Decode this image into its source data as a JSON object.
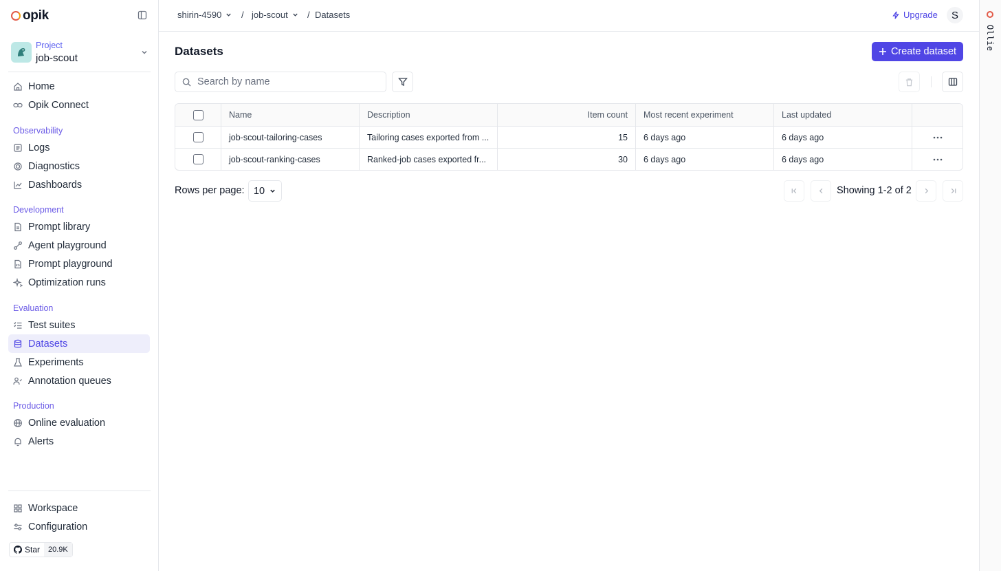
{
  "brand": {
    "name": "opik"
  },
  "project": {
    "label": "Project",
    "name": "job-scout"
  },
  "sidebar": {
    "top": [
      {
        "label": "Home",
        "icon": "home-icon"
      },
      {
        "label": "Opik Connect",
        "icon": "link-icon"
      }
    ],
    "sections": [
      {
        "title": "Observability",
        "items": [
          "Logs",
          "Diagnostics",
          "Dashboards"
        ]
      },
      {
        "title": "Development",
        "items": [
          "Prompt library",
          "Agent playground",
          "Prompt playground",
          "Optimization runs"
        ]
      },
      {
        "title": "Evaluation",
        "items": [
          "Test suites",
          "Datasets",
          "Experiments",
          "Annotation queues"
        ]
      },
      {
        "title": "Production",
        "items": [
          "Online evaluation",
          "Alerts"
        ]
      }
    ],
    "bottom": [
      {
        "label": "Workspace"
      },
      {
        "label": "Configuration"
      }
    ],
    "active": "Datasets",
    "github": {
      "label": "Star",
      "count": "20.9K"
    }
  },
  "topbar": {
    "breadcrumbs": [
      "shirin-4590",
      "job-scout",
      "Datasets"
    ],
    "upgrade_label": "Upgrade",
    "user_initial": "S"
  },
  "right_strip": {
    "text": "Ollie"
  },
  "page": {
    "title": "Datasets",
    "create_label": "Create dataset",
    "search_placeholder": "Search by name"
  },
  "table": {
    "columns": [
      "Name",
      "Description",
      "Item count",
      "Most recent experiment",
      "Last updated"
    ],
    "rows": [
      {
        "name": "job-scout-tailoring-cases",
        "description": "Tailoring cases exported from ...",
        "item_count": "15",
        "recent_experiment": "6 days ago",
        "last_updated": "6 days ago"
      },
      {
        "name": "job-scout-ranking-cases",
        "description": "Ranked-job cases exported fr...",
        "item_count": "30",
        "recent_experiment": "6 days ago",
        "last_updated": "6 days ago"
      }
    ]
  },
  "pagination": {
    "rows_label": "Rows per page:",
    "rows_value": "10",
    "showing": "Showing 1-2 of 2"
  },
  "colors": {
    "accent": "#5046e5",
    "active_bg": "#eeeefb",
    "section_title": "#6b5be6"
  }
}
